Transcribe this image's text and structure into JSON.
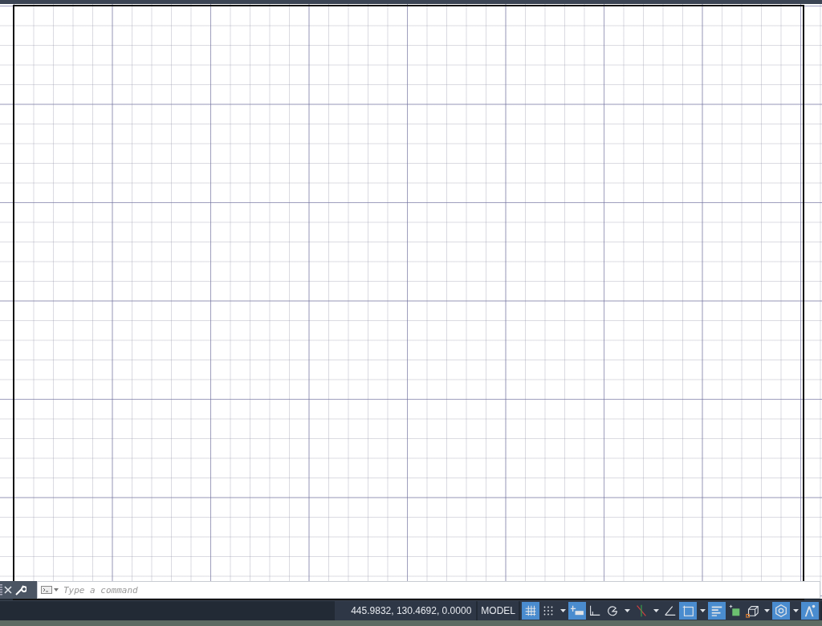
{
  "command_line": {
    "placeholder": "Type a command"
  },
  "status_bar": {
    "coordinates": "445.9832, 130.4692, 0.0000",
    "space": "MODEL",
    "toggles": [
      {
        "kind": "single",
        "on": true
      },
      {
        "kind": "split",
        "on": false
      },
      {
        "kind": "single",
        "on": true
      },
      {
        "kind": "single",
        "on": false
      },
      {
        "kind": "split",
        "on": false
      },
      {
        "kind": "split",
        "on": false
      },
      {
        "kind": "single",
        "on": false
      },
      {
        "kind": "split",
        "on": true
      },
      {
        "kind": "single",
        "on": true
      },
      {
        "kind": "single",
        "on": false
      },
      {
        "kind": "split",
        "on": false
      },
      {
        "kind": "split",
        "on": true
      },
      {
        "kind": "single",
        "on": true
      }
    ]
  }
}
